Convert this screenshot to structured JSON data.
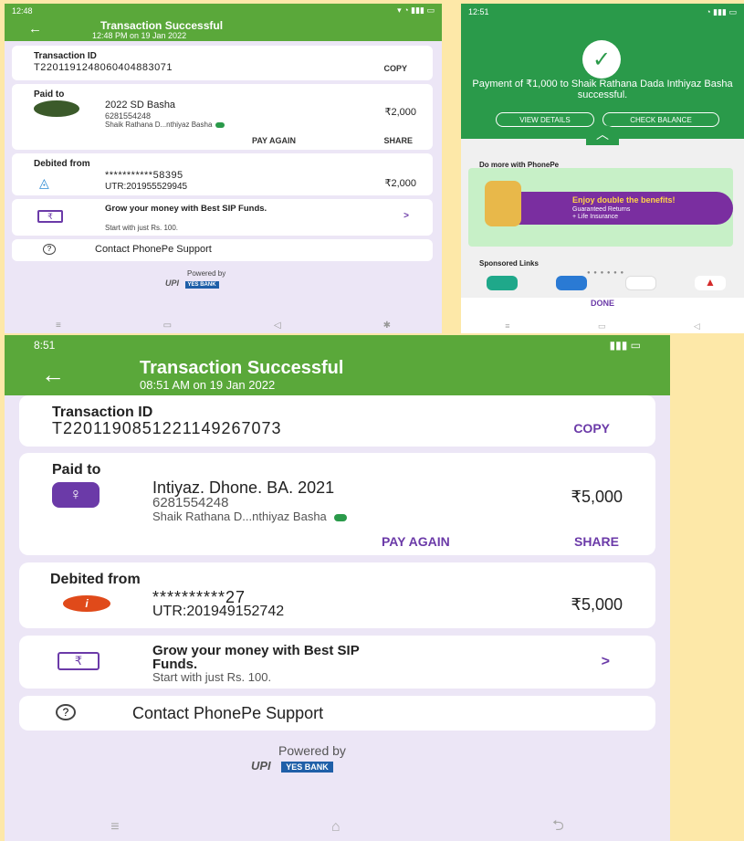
{
  "p1": {
    "status_time": "12:48",
    "title": "Transaction Successful",
    "subtitle": "12:48 PM on 19 Jan 2022",
    "txn_label": "Transaction ID",
    "txn_id": "T2201191248060404883071",
    "copy": "COPY",
    "paid_to_label": "Paid to",
    "payee_name": "2022 SD Basha",
    "payee_phone": "6281554248",
    "payee_account": "Shaik  Rathana D...nthiyaz Basha",
    "paid_amount": "₹2,000",
    "pay_again": "PAY AGAIN",
    "share": "SHARE",
    "debited_label": "Debited from",
    "account_masked": "***********58395",
    "utr": "UTR:201955529945",
    "debited_amount": "₹2,000",
    "sip_title": "Grow your money with Best SIP Funds.",
    "sip_sub": "Start with just Rs. 100.",
    "support": "Contact PhonePe Support",
    "powered_by": "Powered by",
    "upi": "UPI",
    "yes_bank": "YES BANK"
  },
  "p2": {
    "status_time": "12:51",
    "message": "Payment of ₹1,000 to Shaik Rathana Dada Inthiyaz Basha successful.",
    "view_details": "VIEW DETAILS",
    "check_balance": "CHECK BALANCE",
    "do_more": "Do more with PhonePe",
    "promo_title": "Enjoy double the benefits!",
    "promo_line1": "Guaranteed Returns",
    "promo_line2": "+ Life Insurance",
    "sponsored": "Sponsored Links",
    "done": "DONE"
  },
  "p3": {
    "status_time": "8:51",
    "title": "Transaction Successful",
    "subtitle": "08:51 AM on 19 Jan 2022",
    "txn_label": "Transaction ID",
    "txn_id": "T2201190851221149267073",
    "copy": "COPY",
    "paid_to_label": "Paid to",
    "payee_name": "Intiyaz. Dhone. BA. 2021",
    "payee_phone": "6281554248",
    "payee_account": "Shaik  Rathana D...nthiyaz Basha",
    "paid_amount": "₹5,000",
    "pay_again": "PAY AGAIN",
    "share": "SHARE",
    "debited_label": "Debited from",
    "account_masked": "**********27",
    "utr": "UTR:201949152742",
    "debited_amount": "₹5,000",
    "sip_title_1": "Grow your money with Best SIP",
    "sip_title_2": "Funds.",
    "sip_sub": "Start with just Rs. 100.",
    "support": "Contact PhonePe Support",
    "powered_by": "Powered by",
    "upi": "UPI",
    "yes_bank": "YES BANK"
  },
  "colors": {
    "header_green": "#5aa83a",
    "success_green": "#2a9a4a",
    "phonepe_purple": "#6b3aa8",
    "background_cream": "#fde8a8",
    "card_bg": "#ffffff",
    "page_bg": "#ece6f6"
  },
  "icons": [
    "back-arrow-icon",
    "rupee-card-icon",
    "help-circle-icon",
    "chevron-right-icon",
    "check-icon",
    "chevron-up-icon",
    "verified-icon",
    "bank-icon",
    "user-icon"
  ]
}
